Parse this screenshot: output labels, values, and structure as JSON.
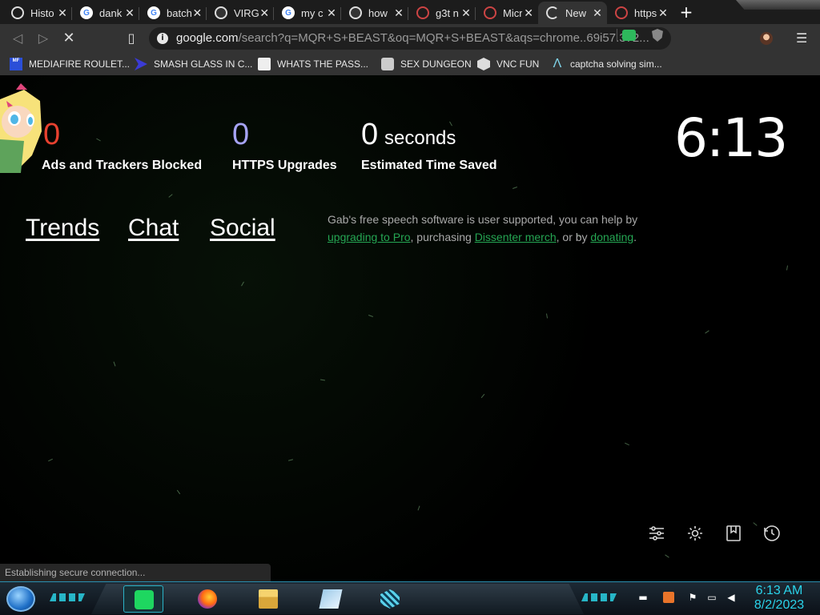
{
  "browser": {
    "tabs": [
      {
        "title": "Histo",
        "icon": "history-icon"
      },
      {
        "title": "dank",
        "icon": "google-icon"
      },
      {
        "title": "batch",
        "icon": "google-icon"
      },
      {
        "title": "VIRG",
        "icon": "brave-icon"
      },
      {
        "title": "my c",
        "icon": "google-icon"
      },
      {
        "title": "how",
        "icon": "brave-icon"
      },
      {
        "title": "g3t n",
        "icon": "site-icon"
      },
      {
        "title": "Micr",
        "icon": "site-icon"
      },
      {
        "title": "New",
        "icon": "loading-icon"
      },
      {
        "title": "https",
        "icon": "site-icon"
      }
    ],
    "new_tab_label": "+",
    "address": {
      "host": "google.com",
      "path": "/search?q=MQR+S+BEAST&oq=MQR+S+BEAST&aqs=chrome..69i57.372..."
    },
    "bookmarks": [
      {
        "label": "MEDIAFIRE ROULET...",
        "icon": "mediafire-icon"
      },
      {
        "label": "SMASH GLASS IN C...",
        "icon": "play-arrow-icon"
      },
      {
        "label": "WHATS THE PASS...",
        "icon": "page-icon"
      },
      {
        "label": "SEX DUNGEON",
        "icon": "dungeon-icon"
      },
      {
        "label": "VNC FUN",
        "icon": "vnc-icon"
      },
      {
        "label": "captcha solving sim...",
        "icon": "lambda-icon"
      }
    ]
  },
  "newtab": {
    "stats": [
      {
        "value": "0",
        "label": "Ads and Trackers Blocked",
        "color": "#e8412f"
      },
      {
        "value": "0",
        "label": "HTTPS Upgrades",
        "color": "#a6a3f5"
      },
      {
        "value": "0",
        "unit": "seconds",
        "label": "Estimated Time Saved",
        "color": "#ffffff"
      }
    ],
    "clock": "6:13",
    "links": [
      "Trends",
      "Chat",
      "Social"
    ],
    "promo": {
      "part1": "Gab's free speech software is user supported, you can help by ",
      "link1": "upgrading to Pro",
      "part2": ", purchasing ",
      "link2": "Dissenter merch",
      "part3": ", or by ",
      "link3": "donating",
      "part4": "."
    },
    "tools": [
      "customize-icon",
      "settings-icon",
      "bookmarks-icon",
      "history-icon"
    ]
  },
  "status_text": "Establishing secure connection...",
  "taskbar": {
    "time": "6:13 AM",
    "date": "8/2/2023",
    "apps": [
      "spotify-icon",
      "firefox-icon",
      "file-explorer-icon",
      "notepad-icon",
      "cube-app-icon"
    ]
  },
  "colors": {
    "link_green": "#25a653",
    "taskbar_accent": "#2ad3ea"
  }
}
